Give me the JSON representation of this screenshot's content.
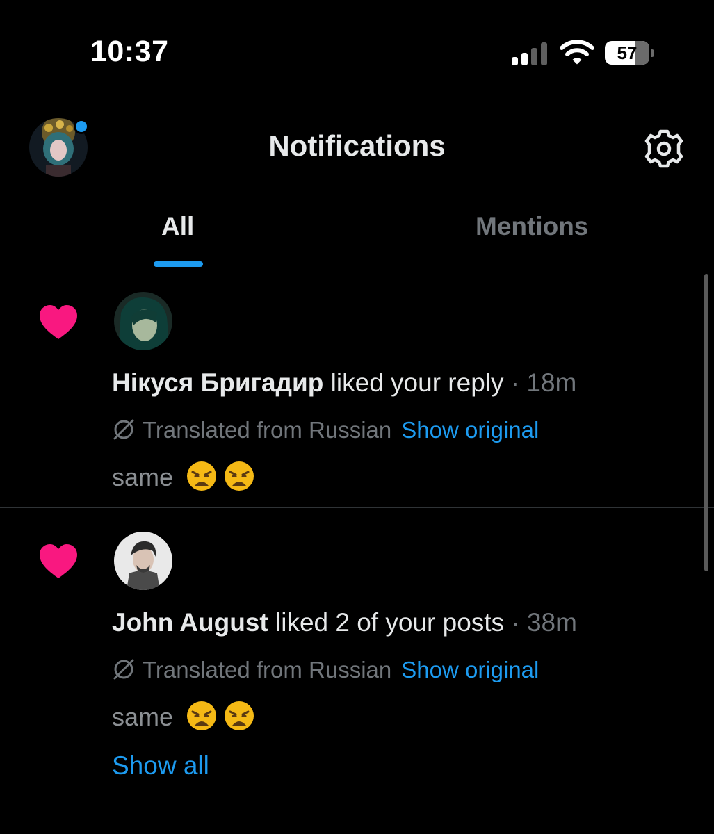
{
  "status_bar": {
    "time": "10:37",
    "battery": "57",
    "battery_level": 0.57,
    "signal_bars_active": 2,
    "signal_bars_total": 4
  },
  "header": {
    "title": "Notifications",
    "settings_icon": "gear-icon",
    "has_unread_dot": true
  },
  "tabs": [
    {
      "label": "All",
      "active": true
    },
    {
      "label": "Mentions",
      "active": false
    }
  ],
  "notifications": [
    {
      "icon": "heart-icon",
      "actor": "Нікуся Бригадир",
      "action": "liked your reply",
      "separator": "·",
      "time": "18m",
      "translated_label": "Translated from Russian",
      "show_original": "Show original",
      "preview_text": "same",
      "preview_emojis": [
        "weary-face-emoji",
        "weary-face-emoji"
      ]
    },
    {
      "icon": "heart-icon",
      "actor": "John August",
      "action": "liked 2 of your posts",
      "separator": "·",
      "time": "38m",
      "translated_label": "Translated from Russian",
      "show_original": "Show original",
      "preview_text": "same",
      "preview_emojis": [
        "weary-face-emoji",
        "weary-face-emoji"
      ],
      "show_all": "Show all"
    }
  ],
  "colors": {
    "background": "#000000",
    "accent": "#1d9bf0",
    "like": "#f91880",
    "text": "#e7e9ea",
    "muted": "#71767b",
    "divider": "#2f3336"
  }
}
